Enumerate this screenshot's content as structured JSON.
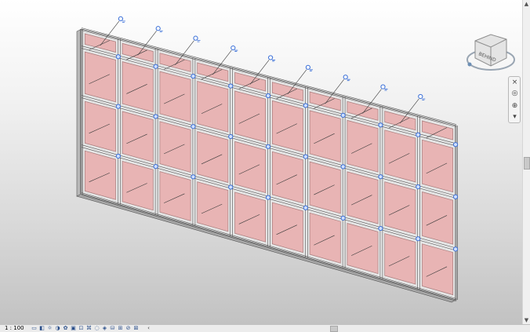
{
  "viewcube": {
    "face_label": "BEHIND",
    "colors": {
      "cube": "#e4e4e4",
      "ring": "#9aa6b3"
    }
  },
  "navigation_bar": {
    "buttons": [
      {
        "icon": "steering-wheel-icon",
        "glyph": "◎"
      },
      {
        "icon": "zoom-icon",
        "glyph": "⊕"
      }
    ]
  },
  "status_bar": {
    "scale": "1 : 100",
    "icons": [
      "detail-level-icon",
      "visual-style-icon",
      "sun-path-icon",
      "shadows-icon",
      "render-icon",
      "crop-view-icon",
      "show-crop-icon",
      "temporary-hide-icon",
      "reveal-hidden-icon",
      "temporary-view-properties-icon",
      "worksharing-icon",
      "analytical-model-icon",
      "highlight-displacement-icon",
      "constraints-icon"
    ],
    "scroll_left_glyph": "‹"
  },
  "scrollbar": {
    "up_glyph": "▲",
    "down_glyph": "▼"
  },
  "model": {
    "type": "curtain-wall",
    "columns": 10,
    "row_height_ratios": [
      0.11,
      0.3,
      0.3,
      0.29
    ],
    "colors": {
      "panel": "#e8b4b4",
      "panel_edge": "#a87a7a",
      "mullion": "#e6e6e6",
      "mullion_edge": "#555555",
      "control": "#3a6fd8",
      "control_fill": "#cfe0ff",
      "leader": "#3a3a3a"
    }
  }
}
